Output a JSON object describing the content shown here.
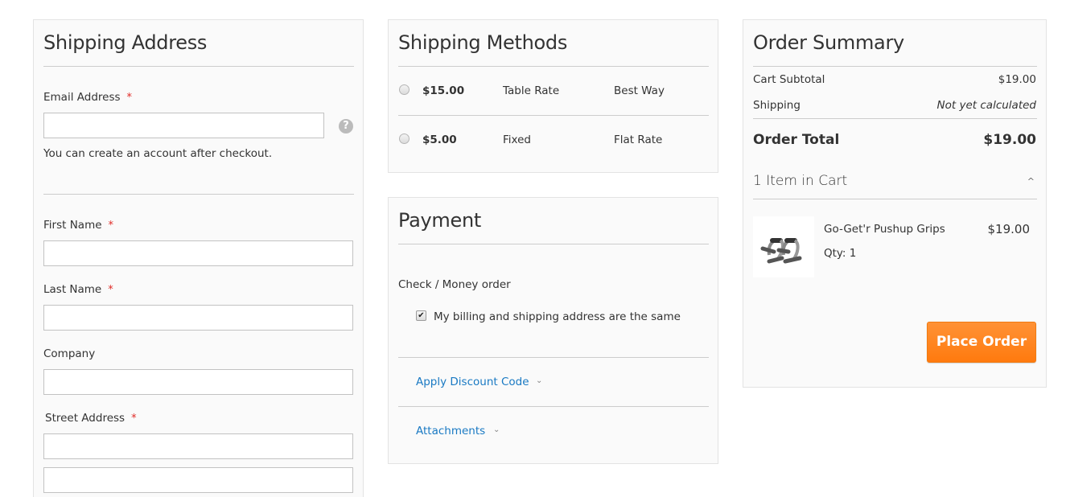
{
  "shipping_address": {
    "title": "Shipping Address",
    "email_label": "Email Address",
    "email_value": "",
    "help_icon": "?",
    "email_note": "You can create an account after checkout.",
    "required_marker": "*",
    "first_name_label": "First Name",
    "first_name_value": "",
    "last_name_label": "Last Name",
    "last_name_value": "",
    "company_label": "Company",
    "company_value": "",
    "street_label": "Street Address",
    "street_line1_value": "",
    "street_line2_value": ""
  },
  "shipping_methods": {
    "title": "Shipping Methods",
    "methods": [
      {
        "price": "$15.00",
        "method": "Table Rate",
        "carrier": "Best Way",
        "selected": false
      },
      {
        "price": "$5.00",
        "method": "Fixed",
        "carrier": "Flat Rate",
        "selected": false
      }
    ]
  },
  "payment": {
    "title": "Payment",
    "method_name": "Check / Money order",
    "same_address_label": "My billing and shipping address are the same",
    "same_address_checked": true,
    "check_glyph": "✔",
    "discount_link": "Apply Discount Code",
    "attachments_link": "Attachments",
    "chevron_glyph": "⌄"
  },
  "order_summary": {
    "title": "Order Summary",
    "subtotal_label": "Cart Subtotal",
    "subtotal_value": "$19.00",
    "shipping_label": "Shipping",
    "shipping_value": "Not yet calculated",
    "total_label": "Order Total",
    "total_value": "$19.00",
    "items_title": "1 Item in Cart",
    "collapse_glyph": "^",
    "items": [
      {
        "name": "Go-Get'r Pushup Grips",
        "qty_label": "Qty: 1",
        "price": "$19.00"
      }
    ],
    "place_order_label": "Place Order"
  },
  "colors": {
    "accent_orange": "#ff7a0e",
    "link_blue": "#1979c3",
    "required_red": "#e02b27"
  }
}
